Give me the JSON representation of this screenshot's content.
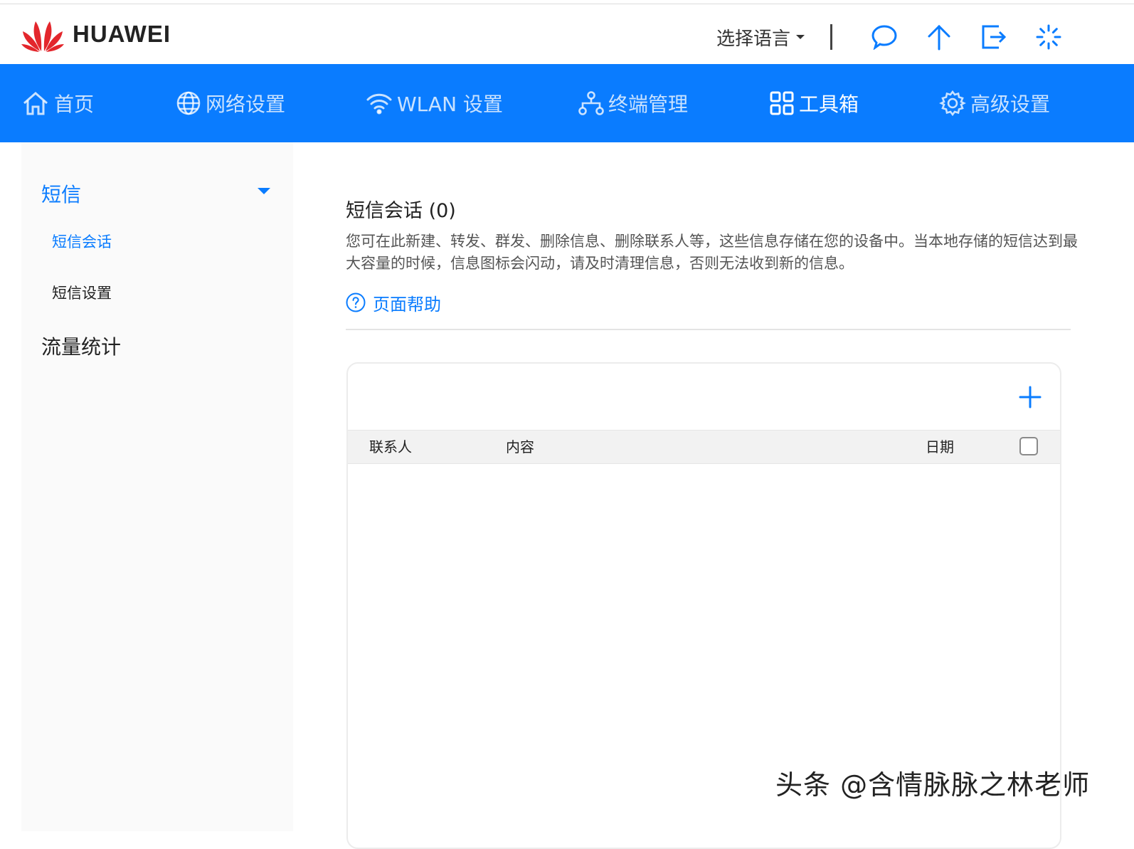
{
  "header": {
    "brand": "HUAWEI",
    "language_selector": "选择语言"
  },
  "nav": {
    "items": [
      {
        "label": "首页",
        "icon": "home-icon"
      },
      {
        "label": "网络设置",
        "icon": "globe-icon"
      },
      {
        "label": "WLAN 设置",
        "icon": "wifi-icon"
      },
      {
        "label": "终端管理",
        "icon": "devices-icon"
      },
      {
        "label": "工具箱",
        "icon": "grid-icon",
        "active": true
      },
      {
        "label": "高级设置",
        "icon": "gear-icon"
      }
    ]
  },
  "sidebar": {
    "groups": [
      {
        "label": "短信",
        "expanded": true,
        "items": [
          {
            "label": "短信会话",
            "active": true
          },
          {
            "label": "短信设置"
          }
        ]
      },
      {
        "label": "流量统计"
      }
    ]
  },
  "main": {
    "title": "短信会话 (0)",
    "description": "您可在此新建、转发、群发、删除信息、删除联系人等，这些信息存储在您的设备中。当本地存储的短信达到最大容量的时候，信息图标会闪动，请及时清理信息，否则无法收到新的信息。",
    "help_label": "页面帮助",
    "table": {
      "columns": [
        "联系人",
        "内容",
        "日期"
      ],
      "rows": []
    }
  },
  "watermark": "头条 @含情脉脉之林老师",
  "colors": {
    "accent": "#0a7cff",
    "brand_red": "#e3262c"
  }
}
